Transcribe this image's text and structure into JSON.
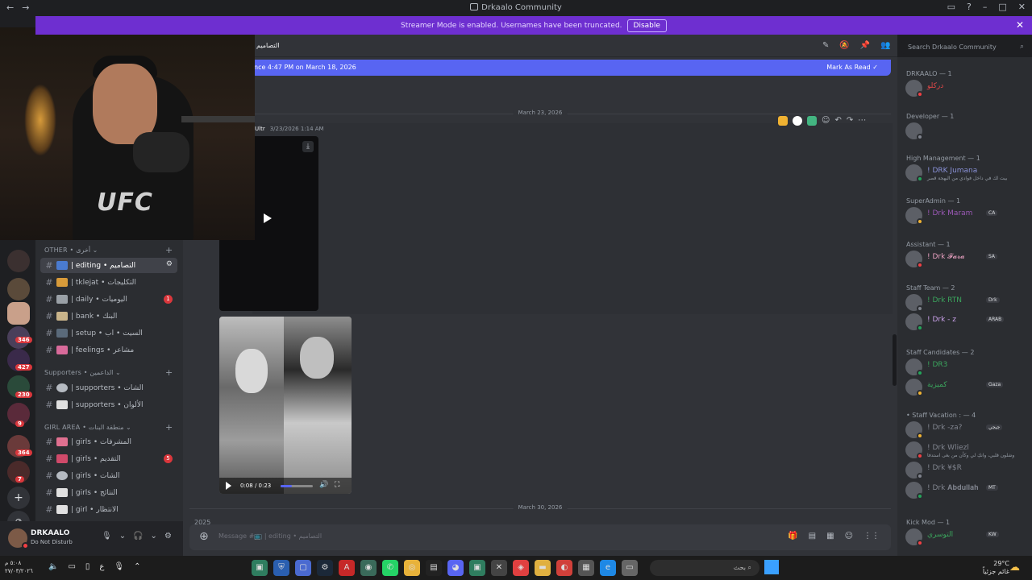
{
  "titlebar": {
    "title": "Drkaalo Community"
  },
  "banner": {
    "text": "Streamer Mode is enabled. Usernames have been truncated.",
    "button": "Disable"
  },
  "rail": {
    "badges": [
      "346",
      "427",
      "230",
      "9",
      "364",
      "7"
    ]
  },
  "channels": {
    "categories": {
      "other": "OTHER • أخرى ⌄",
      "supporters": "Supporters • الداعمين ⌄",
      "girls": "GIRL AREA • منطقة البنات ⌄"
    },
    "items": [
      {
        "label": "| editing • التصاميم",
        "active": true
      },
      {
        "label": "| tklejat • التكليجات"
      },
      {
        "label": "| daily • اليوميات",
        "badge": "1"
      },
      {
        "label": "| bank • البنك"
      },
      {
        "label": "| setup • السيت • اب"
      },
      {
        "label": "| feelings • مشاعر"
      },
      {
        "label": "| supporters • الشات"
      },
      {
        "label": "| supporters • الألوان"
      },
      {
        "label": "| girls • المشرفات"
      },
      {
        "label": "| girls • التقديم",
        "badge": "5"
      },
      {
        "label": "| girls • الشات"
      },
      {
        "label": "| girls • النتائج"
      },
      {
        "label": "| girl • الانتظار"
      }
    ]
  },
  "user": {
    "name": "DRKAALO",
    "status": "Do Not Disturb"
  },
  "chat": {
    "channel_name": "التصاميم",
    "new_messages": "nce 4:47 PM on March 18, 2026",
    "mark_read": "Mark As Read",
    "date1": "March 23, 2026",
    "date2": "March 30, 2026",
    "msg_author": "Ultr",
    "msg_time": "3/23/2026 1:14 AM",
    "video_time": "0:08 / 0:23",
    "video_progress": 0.35,
    "next_msg": "2025",
    "placeholder": "Message #📺 | editing • التصاميم",
    "search_placeholder": "Search Drkaalo Community"
  },
  "members": {
    "groups": [
      {
        "role": "DRKAALO — 1",
        "members": [
          {
            "name": "دركلو",
            "color": "#e04848"
          }
        ]
      },
      {
        "role": "Developer — 1",
        "members": [
          {
            "name": "",
            "color": "#e04848"
          }
        ]
      },
      {
        "role": "High Management — 1",
        "members": [
          {
            "name": "! DRK Jumana",
            "color": "#8a92d8",
            "sub": "بيت لك في داخل فوادي من البهجة قصر"
          }
        ]
      },
      {
        "role": "SuperAdmin — 1",
        "members": [
          {
            "name": "! Drk Maram",
            "color": "#9b59b6",
            "tag": "CA"
          }
        ]
      },
      {
        "role": "Assistant — 1",
        "members": [
          {
            "name": "! Drk 𝓕𝓪𝓻𝓪",
            "color": "#e8a0c0",
            "tag": "SA"
          }
        ]
      },
      {
        "role": "Staff Team — 2",
        "members": [
          {
            "name": "! Drk RTN",
            "color": "#3ba55d",
            "tag": "Drk"
          },
          {
            "name": "! Drk - z",
            "color": "#c9a0e8",
            "tag": "ARAB"
          }
        ]
      },
      {
        "role": "Staff Candidates — 2",
        "members": [
          {
            "name": "! DR3",
            "color": "#3ba55d"
          },
          {
            "name": "كميزية",
            "color": "#3ba55d",
            "tag": "Gaza"
          }
        ]
      },
      {
        "role": "• Staff Vacation : — 4",
        "members": [
          {
            "name": "! Drk -za?",
            "color": "#80848e",
            "tag": "جيجي"
          },
          {
            "name": "! Drk Wliezl",
            "color": "#80848e",
            "sub": "وشلون قلبي، وانكِ لي وكأن من بغى استدفا"
          },
          {
            "name": "! Drk ¥$R",
            "color": "#80848e"
          },
          {
            "name": "! Drk 𝐀𝐛𝐝𝐮𝐥𝐥𝐚𝐡",
            "color": "#80848e",
            "tag": "MT"
          }
        ]
      },
      {
        "role": "Kick Mod — 1",
        "members": [
          {
            "name": "التوسري",
            "color": "#3ba55d",
            "tag": "KW"
          }
        ]
      }
    ]
  },
  "taskbar": {
    "time": "٥:٠٨ م",
    "date": "٢٧/٠٣/٢٠٢٦",
    "search": "بحث",
    "temp": "29°C",
    "weather": "غائم جزئياً"
  },
  "colors": {
    "accent": "#5865f2",
    "banner": "#6e2fd0",
    "dnd": "#f23f43"
  }
}
